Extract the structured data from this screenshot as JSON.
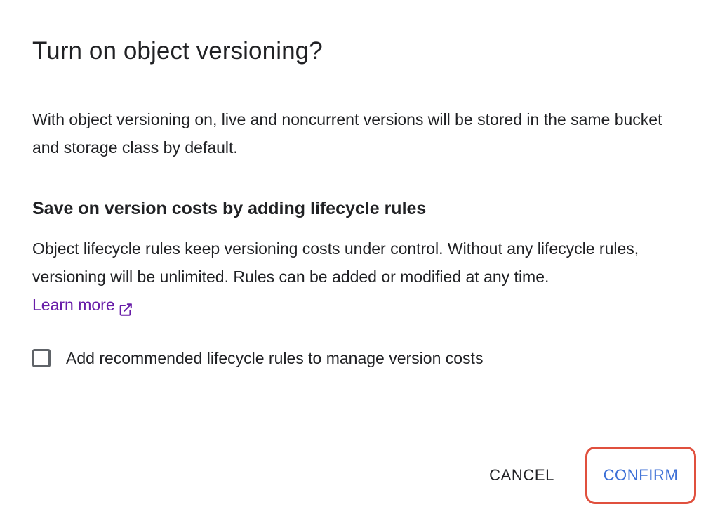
{
  "dialog": {
    "title": "Turn on object versioning?",
    "description": "With object versioning on, live and noncurrent versions will be stored in the same bucket and storage class by default.",
    "lifecycle_heading": "Save on version costs by adding lifecycle rules",
    "lifecycle_text": "Object lifecycle rules keep versioning costs under control. Without any lifecycle rules, versioning will be unlimited. Rules can be added or modified at any time.",
    "learn_more_label": "Learn more",
    "learn_more_icon": "open-in-new-icon",
    "checkbox_label": "Add recommended lifecycle rules to manage version costs",
    "checkbox_checked": false
  },
  "actions": {
    "cancel_label": "CANCEL",
    "confirm_label": "CONFIRM"
  },
  "colors": {
    "text": "#202124",
    "link": "#681da8",
    "primary": "#3c6fd6",
    "highlight": "#e0503e"
  }
}
